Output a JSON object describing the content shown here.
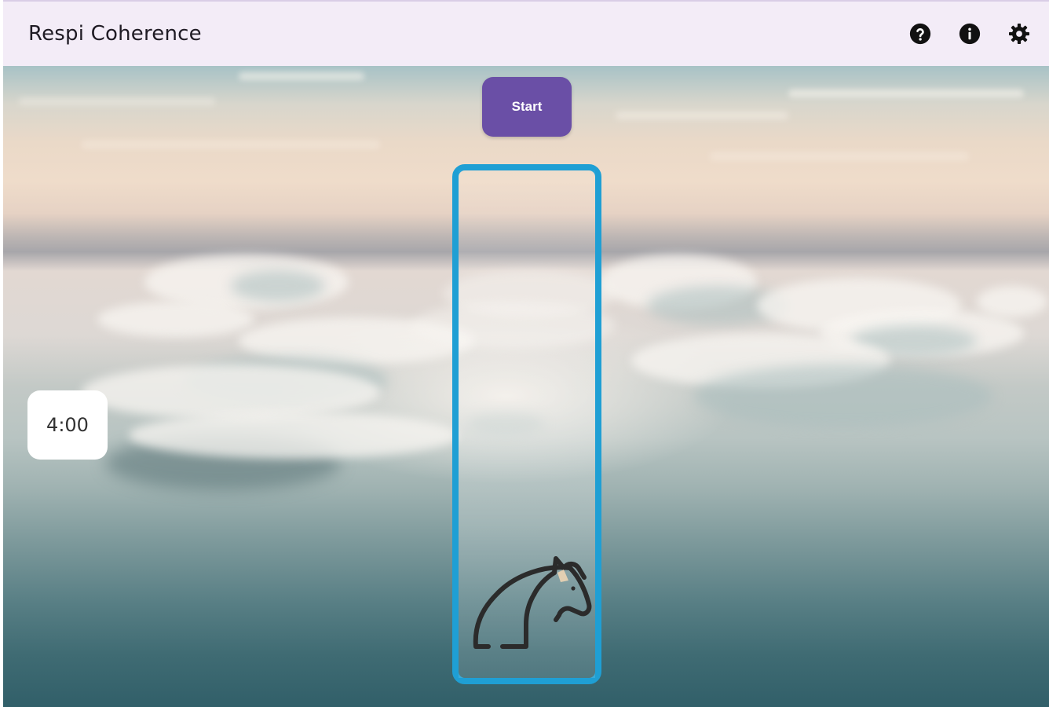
{
  "app": {
    "title": "Respi Coherence"
  },
  "toolbar": {
    "icons": [
      "help-icon",
      "info-icon",
      "settings-icon"
    ]
  },
  "controls": {
    "start_label": "Start"
  },
  "timer": {
    "value": "4:00"
  },
  "gauge": {
    "level": 0,
    "marker_icon": "horse-icon"
  },
  "colors": {
    "appbar_bg": "#f3ecf7",
    "accent": "#6a4fa6",
    "gauge_border": "#1f9fd4",
    "icon": "#111111"
  }
}
